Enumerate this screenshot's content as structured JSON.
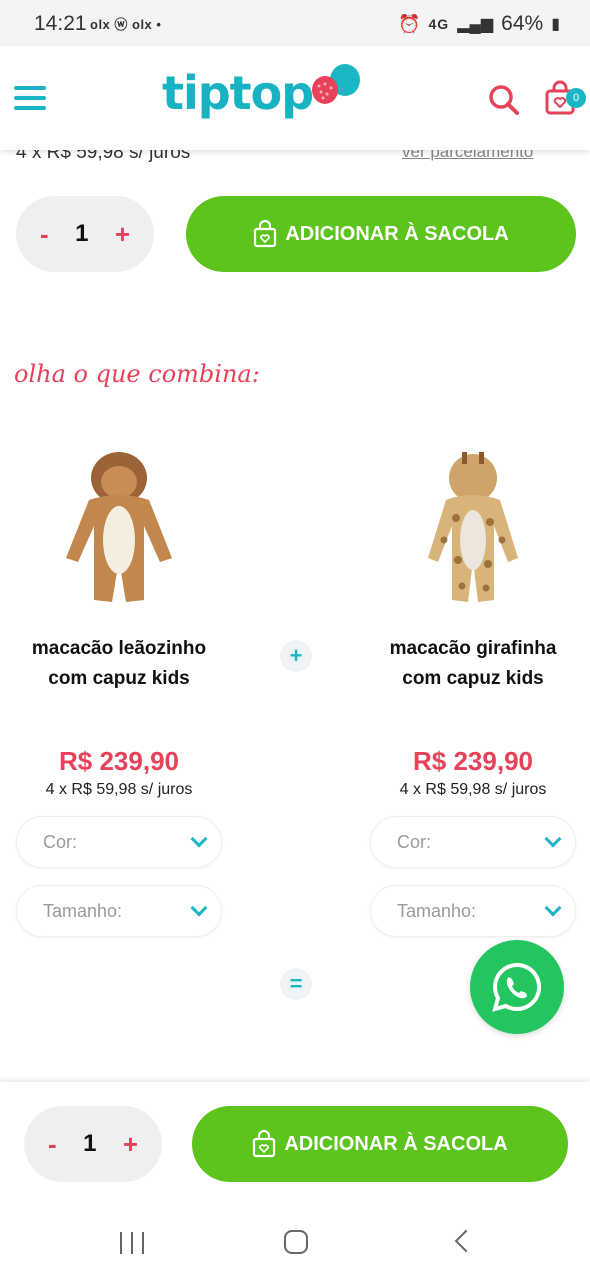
{
  "status_bar": {
    "time": "14:21",
    "apps": "olx ⓦ olx •",
    "network": "4G",
    "battery": "64%"
  },
  "header": {
    "logo": "tiptop",
    "cart_count": "0"
  },
  "top": {
    "installments": "4 x R$ 59,98 s/ juros",
    "installments_link": "ver parcelamento"
  },
  "purchase": {
    "quantity": "1",
    "minus": "-",
    "plus": "+",
    "add_label": "ADICIONAR À SACOLA"
  },
  "section": {
    "title": "olha o que combina:"
  },
  "products": [
    {
      "name_line1": "macacão leãozinho",
      "name_line2": "com capuz kids",
      "price": "R$ 239,90",
      "installments": "4 x R$ 59,98 s/ juros",
      "color_label": "Cor:",
      "size_label": "Tamanho:"
    },
    {
      "name_line1": "macacão girafinha",
      "name_line2": "com capuz kids",
      "price": "R$ 239,90",
      "installments": "4 x R$ 59,98 s/ juros",
      "color_label": "Cor:",
      "size_label": "Tamanho:"
    }
  ],
  "combo": {
    "plus_symbol": "+",
    "equals_symbol": "="
  },
  "bottom": {
    "quantity": "1",
    "minus": "-",
    "plus": "+",
    "add_label": "ADICIONAR À SACOLA"
  },
  "colors": {
    "brand": "#17b3c2",
    "accent": "#e8425a",
    "cta": "#5cc41c",
    "whatsapp": "#23c55e"
  },
  "icons": [
    "menu-icon",
    "search-icon",
    "bag-icon",
    "shopping-bag-icon",
    "chevron-down-icon",
    "whatsapp-icon",
    "recents-icon",
    "home-icon",
    "back-icon"
  ]
}
